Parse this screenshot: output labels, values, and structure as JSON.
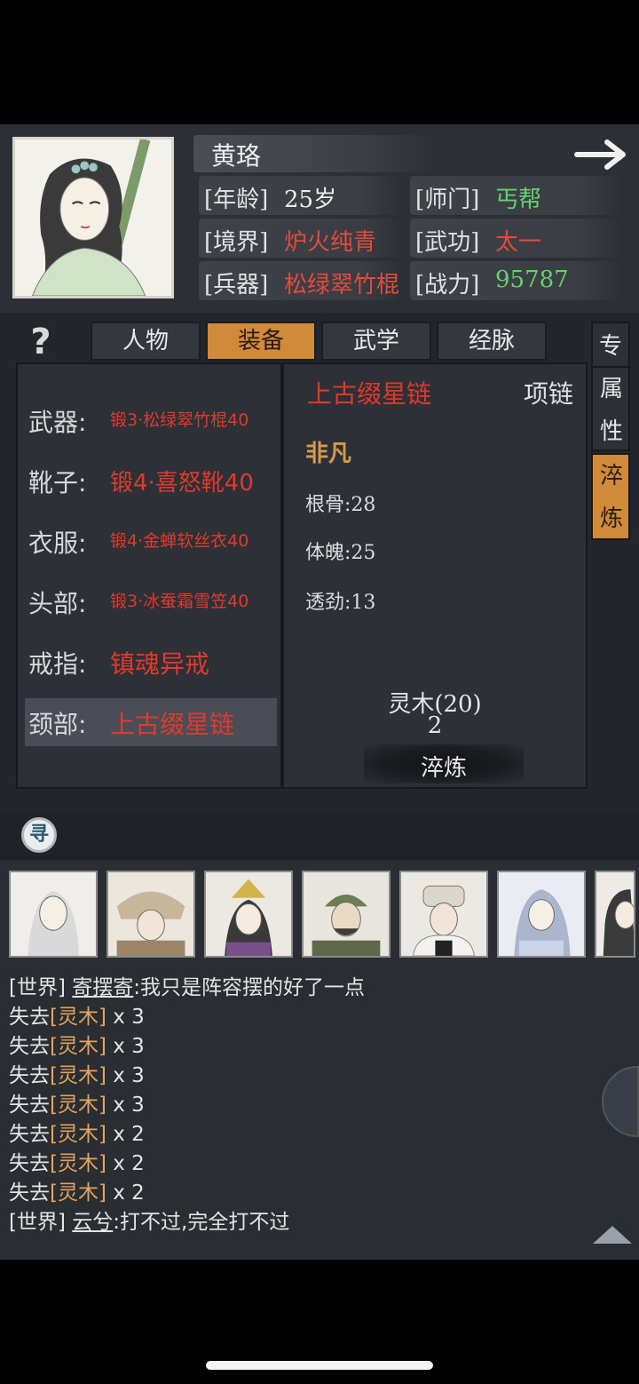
{
  "character": {
    "name": "黄珞",
    "rows": [
      {
        "label_left": "[年龄]",
        "value_left": "25岁",
        "label_right": "[师门]",
        "value_right": "丐帮"
      },
      {
        "label_left": "[境界]",
        "value_left": "炉火纯青",
        "label_right": "[武功]",
        "value_right": "太一"
      },
      {
        "label_left": "[兵器]",
        "value_left": "松绿翠竹棍",
        "label_right": "[战力]",
        "value_right": "95787"
      }
    ]
  },
  "help": {
    "label": "?"
  },
  "tabs": [
    {
      "label": "人物"
    },
    {
      "label": "装备"
    },
    {
      "label": "武学"
    },
    {
      "label": "经脉"
    }
  ],
  "side_tabs": [
    {
      "label": "专"
    },
    {
      "label": "属性"
    },
    {
      "label": "淬炼"
    }
  ],
  "equipment": [
    {
      "label": "武器:",
      "value": "锻3·松绿翠竹棍40"
    },
    {
      "label": "靴子:",
      "value": "锻4·喜怒靴40"
    },
    {
      "label": "衣服:",
      "value": "锻4·金蝉软丝衣40"
    },
    {
      "label": "头部:",
      "value": "锻3·冰蚕霜雪笠40"
    },
    {
      "label": "戒指:",
      "value": "镇魂异戒"
    },
    {
      "label": "颈部:",
      "value": "上古缀星链"
    }
  ],
  "detail": {
    "item_name": "上古缀星链",
    "item_type": "项链",
    "grade": "非凡",
    "stats": [
      "根骨:28",
      "体魄:25",
      "透劲:13"
    ],
    "material": "灵木(20)",
    "material_count": "2",
    "refine_button": "淬炼"
  },
  "search": {
    "icon_glyph": "寻"
  },
  "chat": {
    "lines": [
      {
        "prefix": "[世界] ",
        "user": "寄摆寄",
        "text": ":我只是阵容摆的好了一点"
      },
      {
        "prefix": "失去",
        "item": "[灵木]",
        "text": " x 3"
      },
      {
        "prefix": "失去",
        "item": "[灵木]",
        "text": " x 3"
      },
      {
        "prefix": "失去",
        "item": "[灵木]",
        "text": " x 3"
      },
      {
        "prefix": "失去",
        "item": "[灵木]",
        "text": " x 3"
      },
      {
        "prefix": "失去",
        "item": "[灵木]",
        "text": " x 2"
      },
      {
        "prefix": "失去",
        "item": "[灵木]",
        "text": " x 2"
      },
      {
        "prefix": "失去",
        "item": "[灵木]",
        "text": " x 2"
      },
      {
        "prefix": "[世界] ",
        "user": "云兮",
        "text": ":打不过,完全打不过"
      }
    ]
  },
  "colors": {
    "accent_orange": "#d08a3a",
    "red_text": "#e24b3c",
    "green_text": "#62d36e",
    "item_orange": "#e6a35c"
  }
}
